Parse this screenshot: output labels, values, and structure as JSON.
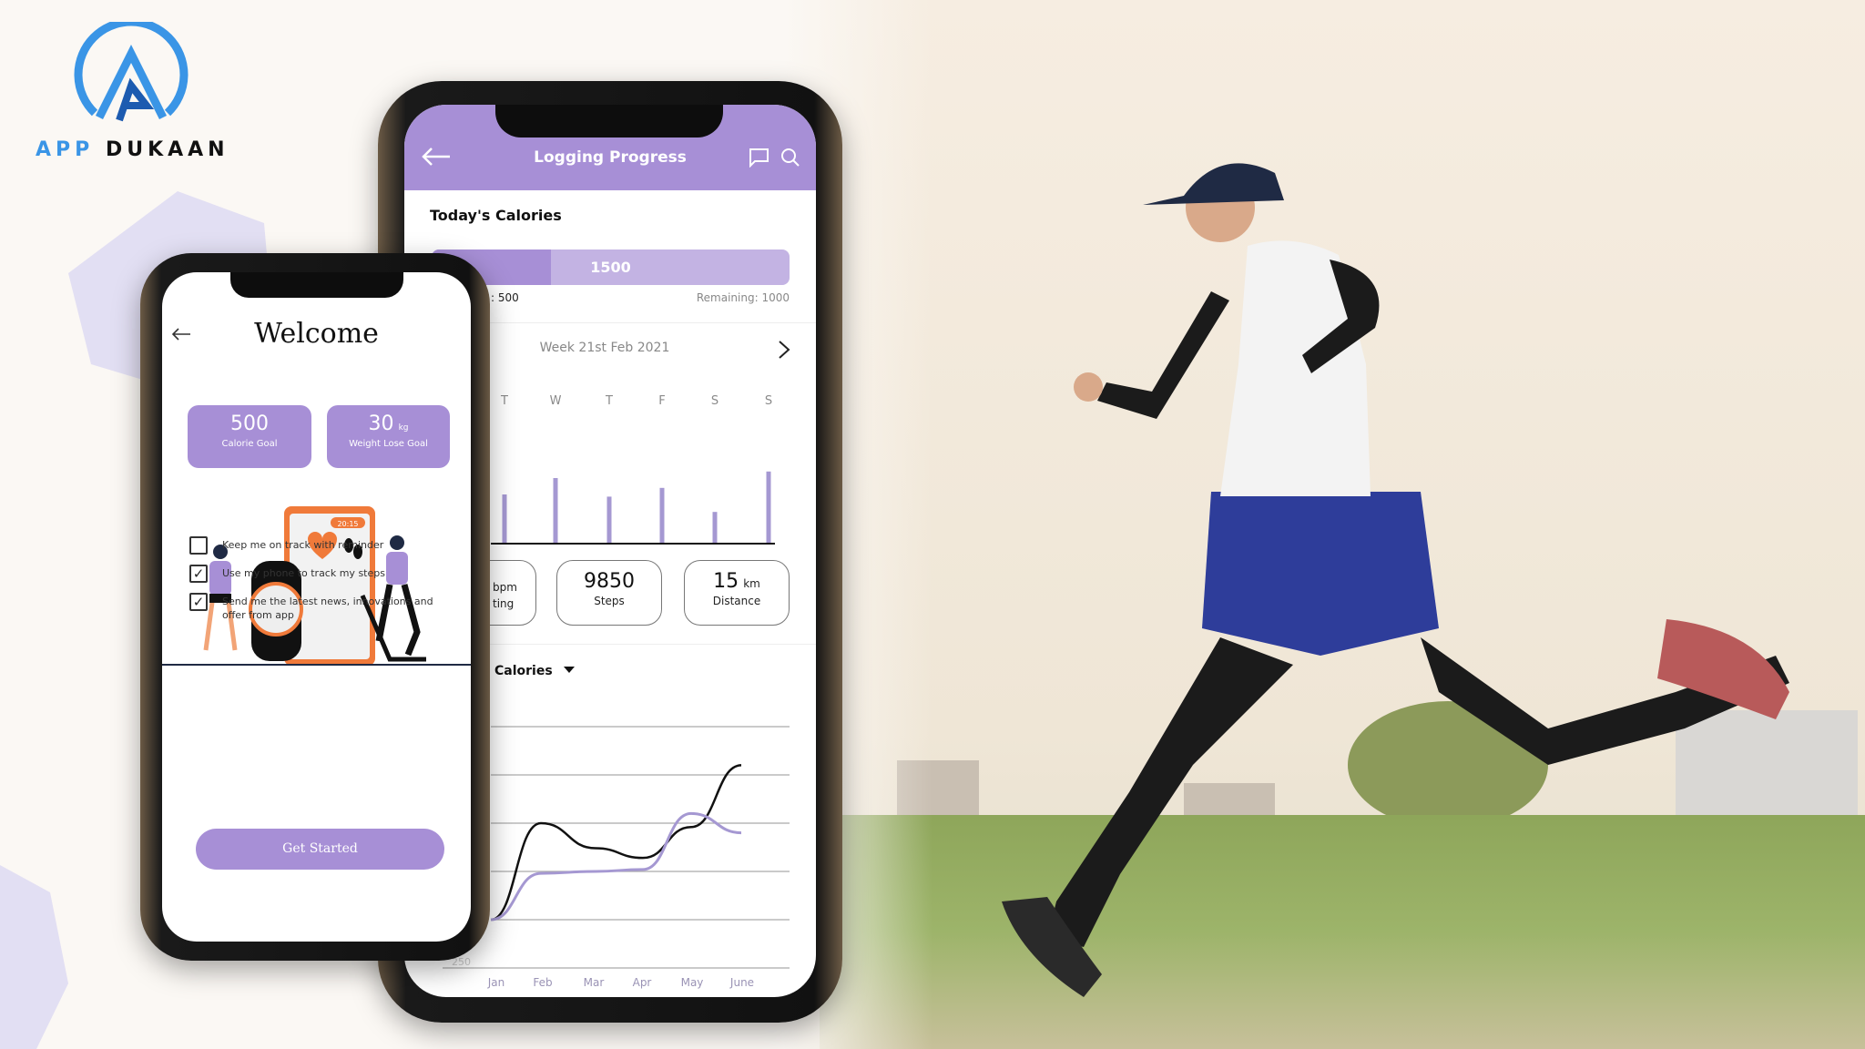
{
  "brand": {
    "name_part1": "APP",
    "name_part2": "DUKAAN",
    "logo_colors": [
      "#3a95e6",
      "#1d5bb0"
    ]
  },
  "back_phone": {
    "header": {
      "title": "Logging Progress",
      "back_icon": "arrow-left-icon",
      "chat_icon": "chat-bubble-icon",
      "search_icon": "search-icon"
    },
    "todays_calories": {
      "heading": "Today's Calories",
      "bar_label": "1500",
      "progress_fraction": 0.333,
      "consumed_label": ": 500",
      "remaining_label": "Remaining: 1000"
    },
    "week": {
      "label": "Week 21st Feb 2021",
      "next_icon": "chevron-right-icon"
    },
    "stats": [
      {
        "value": "",
        "unit": "bpm",
        "label": "ting"
      },
      {
        "value": "9850",
        "unit": "",
        "label": "Steps"
      },
      {
        "value": "15",
        "unit": "km",
        "label": "Distance"
      }
    ],
    "dropdown": {
      "label": "Calories",
      "icon": "caret-down-icon"
    }
  },
  "chart_data": [
    {
      "type": "bar",
      "categories": [
        "T",
        "W",
        "T",
        "F",
        "S",
        "S"
      ],
      "values": [
        0.45,
        0.6,
        0.43,
        0.51,
        0.29,
        0.66
      ],
      "title": "",
      "xlabel": "",
      "ylabel": "",
      "grid": false
    },
    {
      "type": "line",
      "x": [
        "Jan",
        "Feb",
        "Mar",
        "Apr",
        "May",
        "June"
      ],
      "y_tick_labels": [
        "250"
      ],
      "ylim": [
        250,
        1500
      ],
      "grid": true,
      "series": [
        {
          "color": "#111111",
          "values": [
            500,
            1000,
            870,
            820,
            980,
            1300
          ]
        },
        {
          "color": "#a598d2",
          "values": [
            500,
            740,
            750,
            760,
            1050,
            950
          ]
        }
      ],
      "title": "",
      "xlabel": "",
      "ylabel": ""
    }
  ],
  "front_phone": {
    "back_icon": "arrow-left-icon",
    "title": "Welcome",
    "goals": [
      {
        "value": "500",
        "unit": "",
        "label": "Calorie Goal"
      },
      {
        "value": "30",
        "unit": "kg",
        "label": "Weight Lose Goal"
      }
    ],
    "illustration": {
      "clock_text": "20:15"
    },
    "options": [
      {
        "label": "Keep me on track with reminder",
        "checked": false
      },
      {
        "label": "Use my phone to track my steps",
        "checked": true
      },
      {
        "label": "Send me the latest news, innovations and offer from app",
        "checked": true
      }
    ],
    "cta": "Get Started",
    "accent": "#a78fd6"
  }
}
